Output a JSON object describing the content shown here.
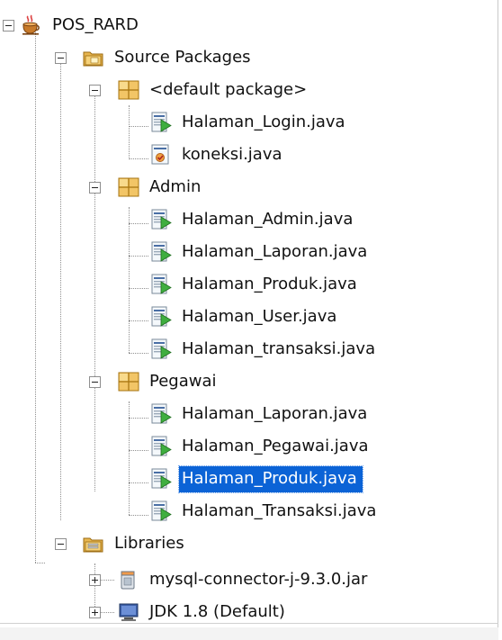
{
  "tree": {
    "project": "POS_RARD",
    "source_packages": "Source Packages",
    "default_package": {
      "label": "<default package>",
      "files": [
        "Halaman_Login.java",
        "koneksi.java"
      ]
    },
    "admin": {
      "label": "Admin",
      "files": [
        "Halaman_Admin.java",
        "Halaman_Laporan.java",
        "Halaman_Produk.java",
        "Halaman_User.java",
        "Halaman_transaksi.java"
      ]
    },
    "pegawai": {
      "label": "Pegawai",
      "files": [
        "Halaman_Laporan.java",
        "Halaman_Pegawai.java",
        "Halaman_Produk.java",
        "Halaman_Transaksi.java"
      ],
      "selected_index": 2
    },
    "libraries": {
      "label": "Libraries",
      "items": [
        "mysql-connector-j-9.3.0.jar",
        "JDK 1.8 (Default)"
      ]
    }
  },
  "colors": {
    "selection": "#0b63d6",
    "tree_lines": "#909090"
  }
}
